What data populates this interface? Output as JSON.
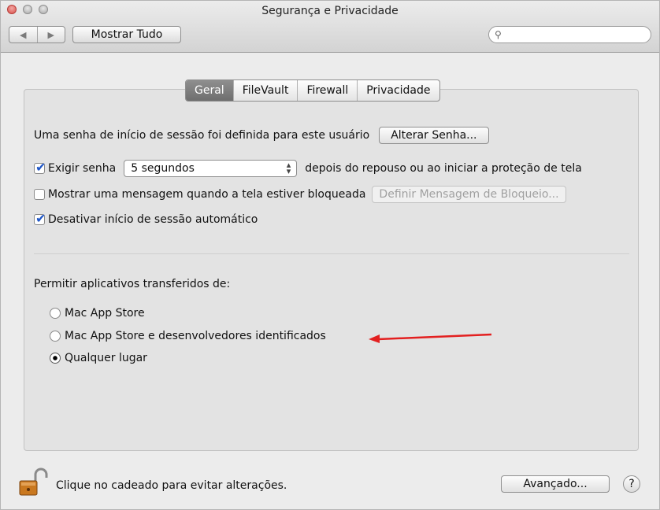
{
  "window": {
    "title": "Segurança e Privacidade"
  },
  "toolbar": {
    "show_all": "Mostrar Tudo",
    "nav_back_icon": "chevron-left-icon",
    "nav_fwd_icon": "chevron-right-icon",
    "search_placeholder": ""
  },
  "tabs": [
    {
      "label": "Geral",
      "active": true
    },
    {
      "label": "FileVault",
      "active": false
    },
    {
      "label": "Firewall",
      "active": false
    },
    {
      "label": "Privacidade",
      "active": false
    }
  ],
  "general": {
    "password_text": "Uma senha de início de sessão foi definida para este usuário",
    "change_password": "Alterar Senha...",
    "require_password": {
      "checked": true,
      "label": "Exigir senha",
      "select_value": "5 segundos",
      "after": "depois do repouso ou ao iniciar a proteção de tela"
    },
    "show_message": {
      "checked": false,
      "label": "Mostrar uma mensagem quando a tela estiver bloqueada",
      "button": "Definir Mensagem de Bloqueio..."
    },
    "disable_auto_login": {
      "checked": true,
      "label": "Desativar início de sessão automático"
    }
  },
  "downloads": {
    "heading": "Permitir aplicativos transferidos de:",
    "options": [
      {
        "label": "Mac App Store",
        "selected": false
      },
      {
        "label": "Mac App Store e desenvolvedores identificados",
        "selected": false
      },
      {
        "label": "Qualquer lugar",
        "selected": true
      }
    ]
  },
  "footer": {
    "lock_text": "Clique no cadeado para evitar alterações.",
    "advanced": "Avançado...",
    "help": "?"
  },
  "colors": {
    "annotation_arrow": "#e32020",
    "checkbox_check": "#1f56c7"
  }
}
